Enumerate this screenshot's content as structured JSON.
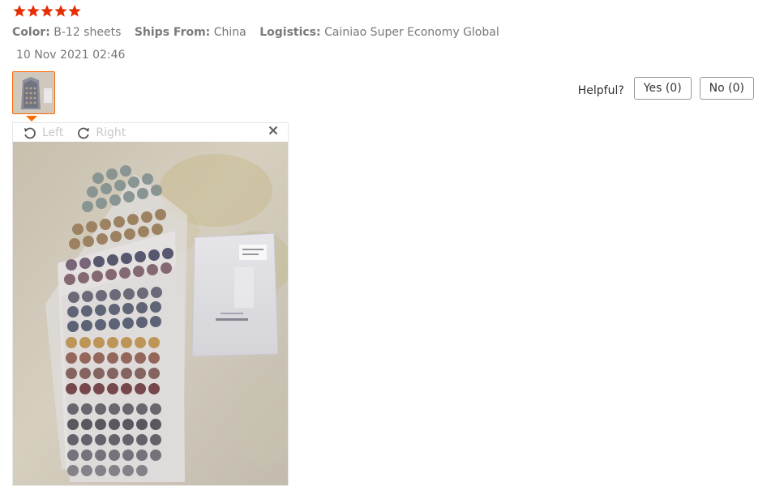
{
  "review": {
    "rating": 5,
    "rating_max": 5,
    "star_color": "#e62e04",
    "accent_color": "#ff6a00",
    "attributes": [
      {
        "label": "Color:",
        "value": "B-12 sheets"
      },
      {
        "label": "Ships From:",
        "value": "China"
      },
      {
        "label": "Logistics:",
        "value": "Cainiao Super Economy Global"
      }
    ],
    "date": "10 Nov 2021 02:46"
  },
  "helpful": {
    "label": "Helpful?",
    "yes_label": "Yes (0)",
    "no_label": "No (0)"
  },
  "viewer": {
    "rotate_left_label": "Left",
    "rotate_right_label": "Right",
    "icons": {
      "rotate_left": "rotate-left-icon",
      "rotate_right": "rotate-right-icon",
      "close": "close-icon"
    }
  }
}
